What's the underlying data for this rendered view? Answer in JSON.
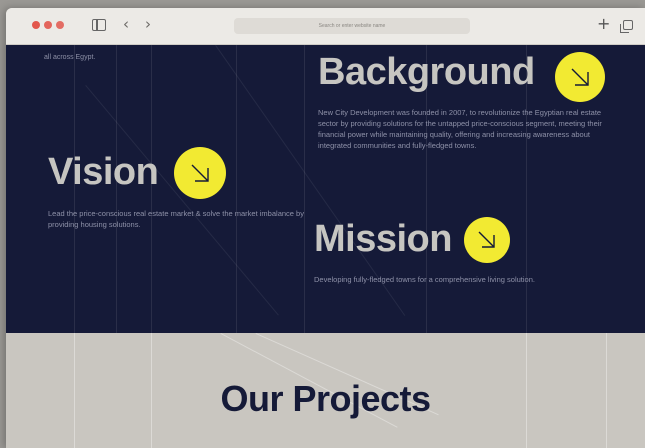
{
  "browser": {
    "address_text": "Search or enter website name",
    "back_icon": "‹",
    "forward_icon": "›",
    "new_tab_icon": "+"
  },
  "hero": {
    "top_fragment": "all across Egypt.",
    "background": {
      "title": "Background",
      "text": "New City Development was founded in 2007, to revolutionize the Egyptian real estate sector by providing solutions for the untapped price-conscious segment, meeting their financial power while maintaining quality, offering and increasing awareness about integrated communities and fully-fledged towns."
    },
    "vision": {
      "title": "Vision",
      "text": "Lead the price-conscious real estate market & solve the market imbalance by providing housing solutions."
    },
    "mission": {
      "title": "Mission",
      "text": "Developing fully-fledged towns for a comprehensive living solution."
    }
  },
  "projects": {
    "title": "Our Projects"
  },
  "colors": {
    "navy": "#151a38",
    "accent_yellow": "#f2ea32",
    "light_section": "#c9c6c0"
  }
}
